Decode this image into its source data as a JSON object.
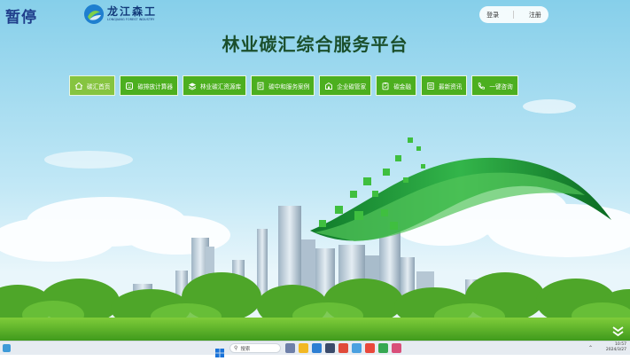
{
  "header": {
    "pause_label": "暂停",
    "logo_cn": "龙江森工",
    "logo_en": "LONGJIANG FOREST INDUSTRY",
    "login_label": "登录",
    "register_label": "注册"
  },
  "page_title": "林业碳汇综合服务平台",
  "nav": {
    "items": [
      {
        "label": "碳汇首页",
        "icon": "home-icon"
      },
      {
        "label": "碳排放计算器",
        "icon": "calculator-icon"
      },
      {
        "label": "林业碳汇资源库",
        "icon": "layers-icon"
      },
      {
        "label": "碳中和服务案例",
        "icon": "document-icon"
      },
      {
        "label": "企业碳管家",
        "icon": "building-icon"
      },
      {
        "label": "碳金融",
        "icon": "clipboard-icon"
      },
      {
        "label": "最新资讯",
        "icon": "news-icon"
      },
      {
        "label": "一键咨询",
        "icon": "phone-icon"
      }
    ]
  },
  "taskbar": {
    "search_placeholder": "搜索",
    "time": "10:57",
    "date": "2024/3/27"
  },
  "colors": {
    "nav_bg": "#4caf1f",
    "nav_active": "#86c440",
    "title": "#1b4f2c",
    "sky_top": "#8fd3ec",
    "grass": "#59b428"
  }
}
